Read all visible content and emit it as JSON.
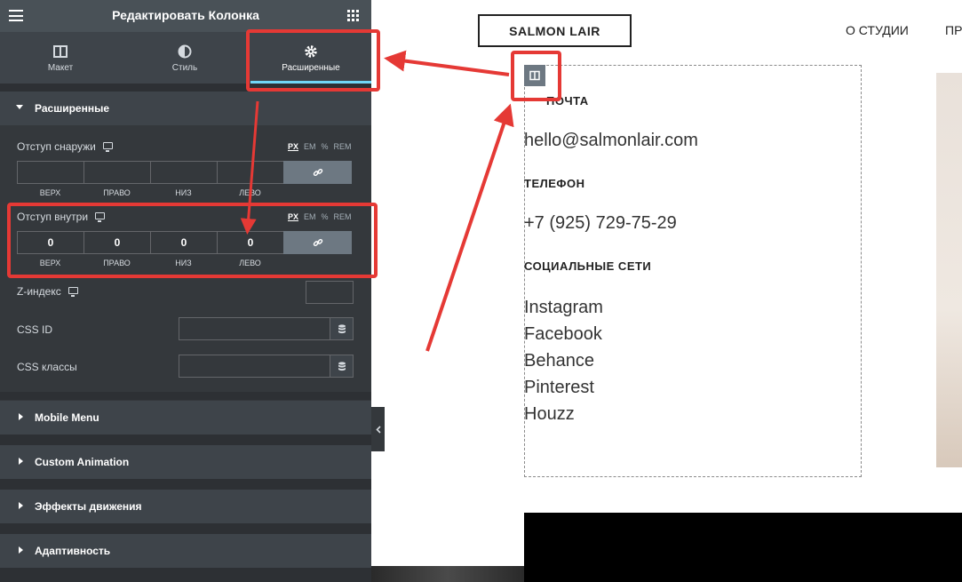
{
  "panel": {
    "title": "Редактировать Колонка",
    "tabs": [
      {
        "label": "Макет",
        "icon": "columns-icon"
      },
      {
        "label": "Стиль",
        "icon": "half-circle-icon"
      },
      {
        "label": "Расширенные",
        "icon": "gear-icon",
        "active": true
      }
    ],
    "advanced_section": "Расширенные",
    "margin": {
      "label": "Отступ снаружи",
      "units": [
        "PX",
        "EM",
        "%",
        "REM"
      ],
      "active_unit": "PX",
      "values": [
        "",
        "",
        "",
        ""
      ],
      "sides": [
        "ВЕРХ",
        "ПРАВО",
        "НИЗ",
        "ЛЕВО"
      ]
    },
    "padding": {
      "label": "Отступ внутри",
      "units": [
        "PX",
        "EM",
        "%",
        "REM"
      ],
      "active_unit": "PX",
      "values": [
        "0",
        "0",
        "0",
        "0"
      ],
      "sides": [
        "ВЕРХ",
        "ПРАВО",
        "НИЗ",
        "ЛЕВО"
      ]
    },
    "z_index_label": "Z-индекс",
    "css_id_label": "CSS ID",
    "css_classes_label": "CSS классы",
    "collapsed_sections": [
      "Mobile Menu",
      "Custom Animation",
      "Эффекты движения",
      "Адаптивность"
    ]
  },
  "preview": {
    "logo": "SALMON LAIR",
    "nav": [
      "О СТУДИИ",
      "ПР"
    ],
    "mail_heading": "ПОЧТА",
    "email": "hello@salmonlair.com",
    "phone_heading": "ТЕЛЕФОН",
    "phone": "+7 (925) 729-75-29",
    "social_heading": "СОЦИАЛЬНЫЕ СЕТИ",
    "social_links": [
      "Instagram",
      "Facebook",
      "Behance",
      "Pinterest",
      "Houzz"
    ]
  },
  "colors": {
    "panel_bg": "#34383c",
    "header_bg": "#495157",
    "active_tab_underline": "#71d7f7",
    "annotation": "#e53935"
  }
}
